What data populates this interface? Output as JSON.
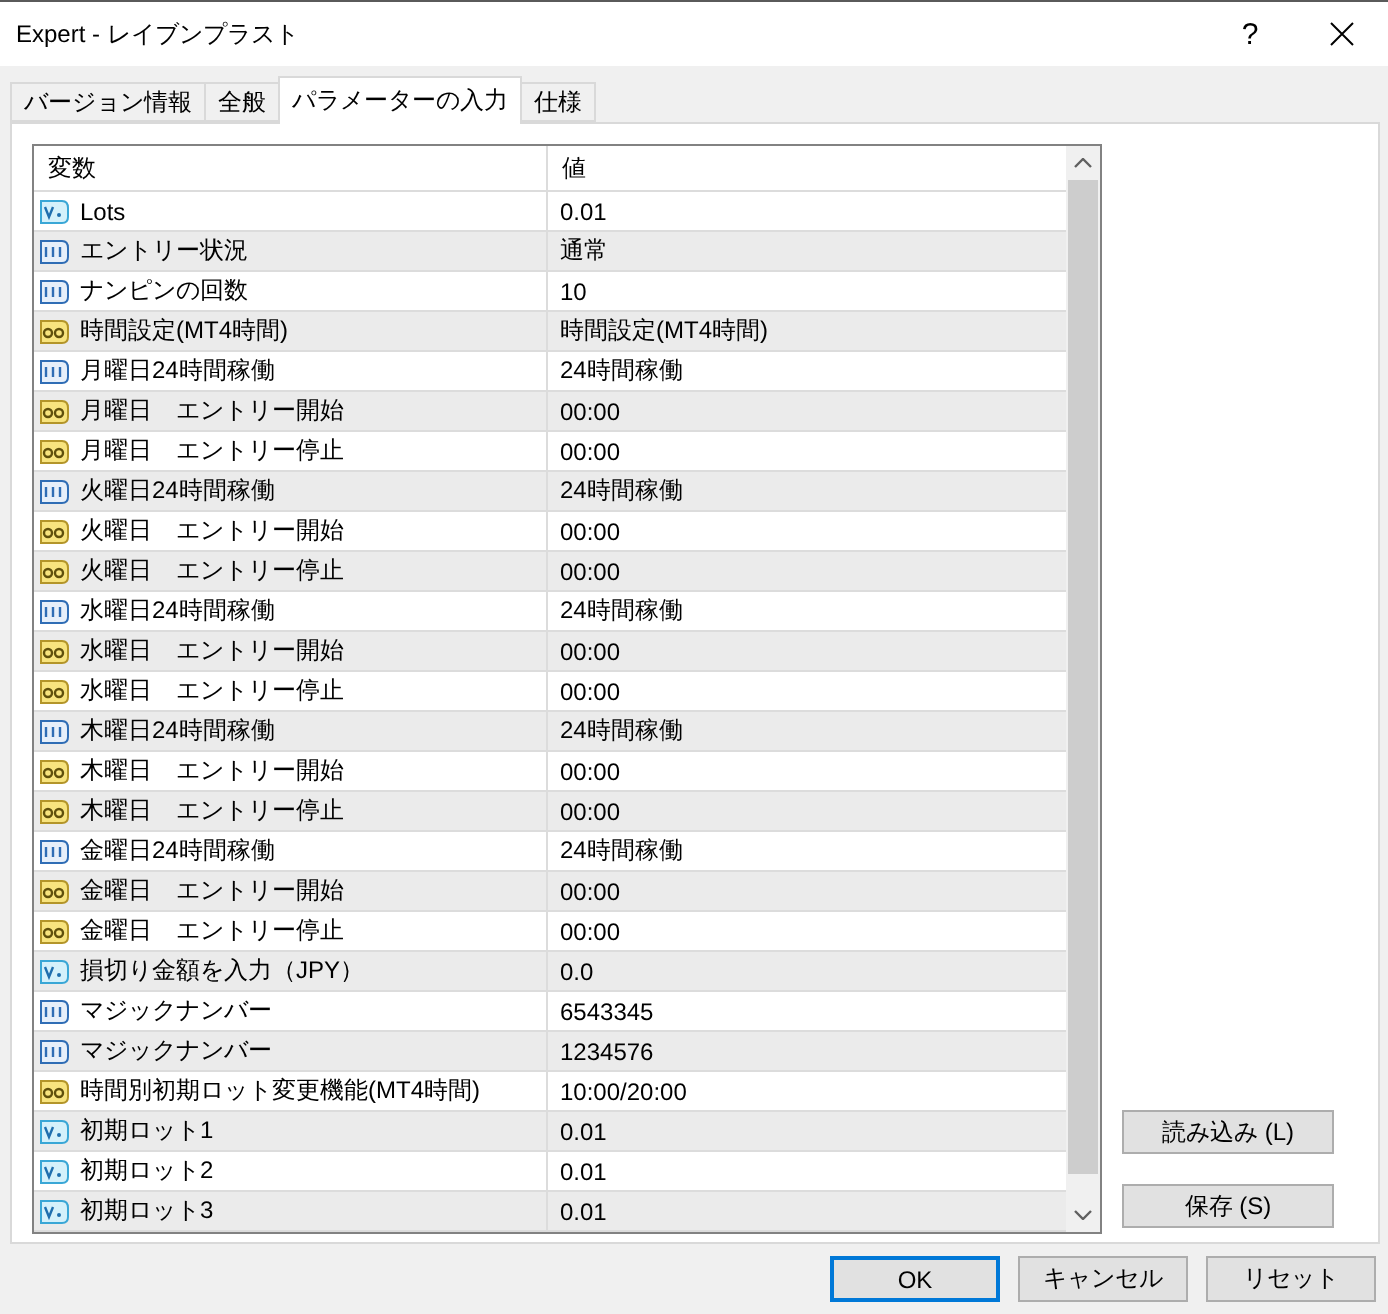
{
  "window": {
    "title": "Expert - レイブンプラスト",
    "help_button": "?"
  },
  "tabs": [
    {
      "label": "バージョン情報",
      "selected": false
    },
    {
      "label": "全般",
      "selected": false
    },
    {
      "label": "パラメーターの入力",
      "selected": true
    },
    {
      "label": "仕様",
      "selected": false
    }
  ],
  "parameters": {
    "columns": [
      "変数",
      "値"
    ],
    "rows": [
      {
        "kind": "double",
        "name": "Lots",
        "value": "0.01"
      },
      {
        "kind": "int",
        "name": "エントリー状況",
        "value": "通常"
      },
      {
        "kind": "int",
        "name": "ナンピンの回数",
        "value": "10"
      },
      {
        "kind": "string",
        "name": "時間設定(MT4時間)",
        "value": "時間設定(MT4時間)"
      },
      {
        "kind": "int",
        "name": "月曜日24時間稼働",
        "value": "24時間稼働"
      },
      {
        "kind": "string",
        "name": "月曜日　エントリー開始",
        "value": "00:00"
      },
      {
        "kind": "string",
        "name": "月曜日　エントリー停止",
        "value": "00:00"
      },
      {
        "kind": "int",
        "name": "火曜日24時間稼働",
        "value": "24時間稼働"
      },
      {
        "kind": "string",
        "name": "火曜日　エントリー開始",
        "value": "00:00"
      },
      {
        "kind": "string",
        "name": "火曜日　エントリー停止",
        "value": "00:00"
      },
      {
        "kind": "int",
        "name": "水曜日24時間稼働",
        "value": "24時間稼働"
      },
      {
        "kind": "string",
        "name": "水曜日　エントリー開始",
        "value": "00:00"
      },
      {
        "kind": "string",
        "name": "水曜日　エントリー停止",
        "value": "00:00"
      },
      {
        "kind": "int",
        "name": "木曜日24時間稼働",
        "value": "24時間稼働"
      },
      {
        "kind": "string",
        "name": "木曜日　エントリー開始",
        "value": "00:00"
      },
      {
        "kind": "string",
        "name": "木曜日　エントリー停止",
        "value": "00:00"
      },
      {
        "kind": "int",
        "name": "金曜日24時間稼働",
        "value": "24時間稼働"
      },
      {
        "kind": "string",
        "name": "金曜日　エントリー開始",
        "value": "00:00"
      },
      {
        "kind": "string",
        "name": "金曜日　エントリー停止",
        "value": "00:00"
      },
      {
        "kind": "double",
        "name": "損切り金額を入力（JPY）",
        "value": "0.0"
      },
      {
        "kind": "int",
        "name": "マジックナンバー",
        "value": "6543345"
      },
      {
        "kind": "int",
        "name": "マジックナンバー",
        "value": "1234576"
      },
      {
        "kind": "string",
        "name": "時間別初期ロット変更機能(MT4時間)",
        "value": "10:00/20:00"
      },
      {
        "kind": "double",
        "name": "初期ロット1",
        "value": "0.01"
      },
      {
        "kind": "double",
        "name": "初期ロット2",
        "value": "0.01"
      },
      {
        "kind": "double",
        "name": "初期ロット3",
        "value": "0.01"
      }
    ]
  },
  "side_buttons": [
    "読み込み (L)",
    "保存 (S)"
  ],
  "buttons": [
    {
      "label": "OK",
      "default": true
    },
    {
      "label": "キャンセル",
      "default": false
    },
    {
      "label": "リセット",
      "default": false
    }
  ]
}
